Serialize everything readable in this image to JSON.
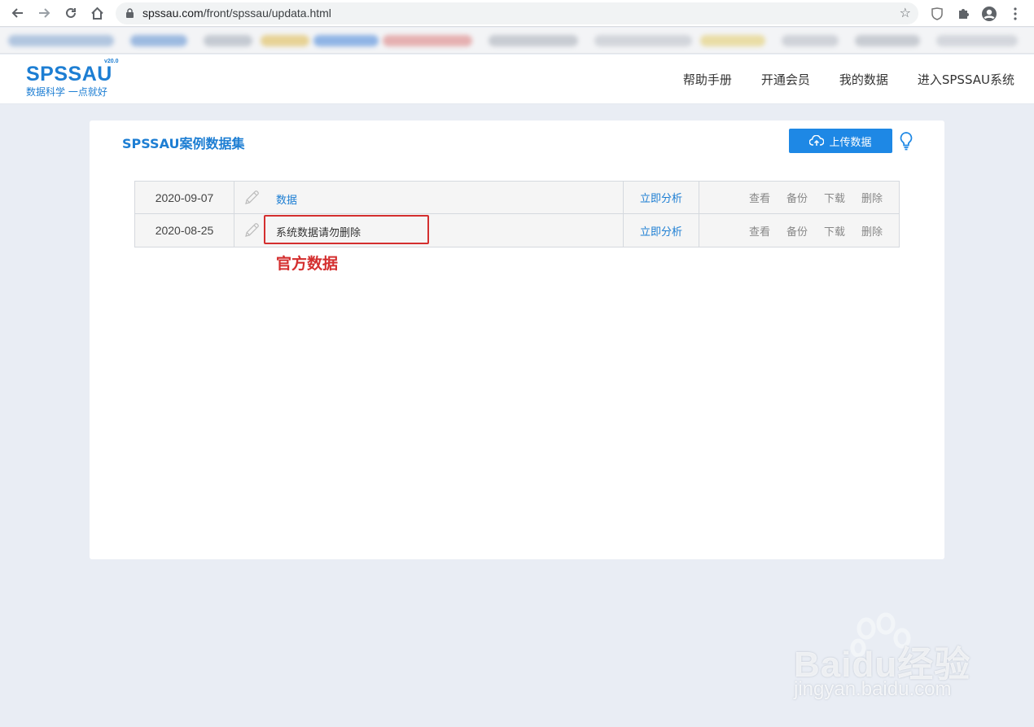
{
  "browser": {
    "url_host": "spssau.com",
    "url_path": "/front/spssau/updata.html"
  },
  "site": {
    "logo_title": "SPSSAU",
    "logo_version": "v20.0",
    "logo_slogan": "数据科学  一点就好",
    "nav": [
      {
        "label": "帮助手册"
      },
      {
        "label": "开通会员"
      },
      {
        "label": "我的数据"
      },
      {
        "label": "进入SPSSAU系统"
      }
    ]
  },
  "page": {
    "title": "SPSSAU案例数据集",
    "upload_label": "上传数据"
  },
  "table": {
    "rows": [
      {
        "date": "2020-09-07",
        "name": "数据",
        "analyze": "立即分析",
        "view": "查看",
        "backup": "备份",
        "download": "下载",
        "delete": "删除"
      },
      {
        "date": "2020-08-25",
        "name": "系统数据请勿删除",
        "analyze": "立即分析",
        "view": "查看",
        "backup": "备份",
        "download": "下载",
        "delete": "删除"
      }
    ]
  },
  "annotation": {
    "label": "官方数据",
    "color": "#d42f2f"
  },
  "watermark": {
    "brand": "Baidu经验",
    "url": "jingyan.baidu.com"
  },
  "colors": {
    "accent": "#1d7ed3",
    "button": "#1e88e5",
    "background": "#e9edf4"
  }
}
